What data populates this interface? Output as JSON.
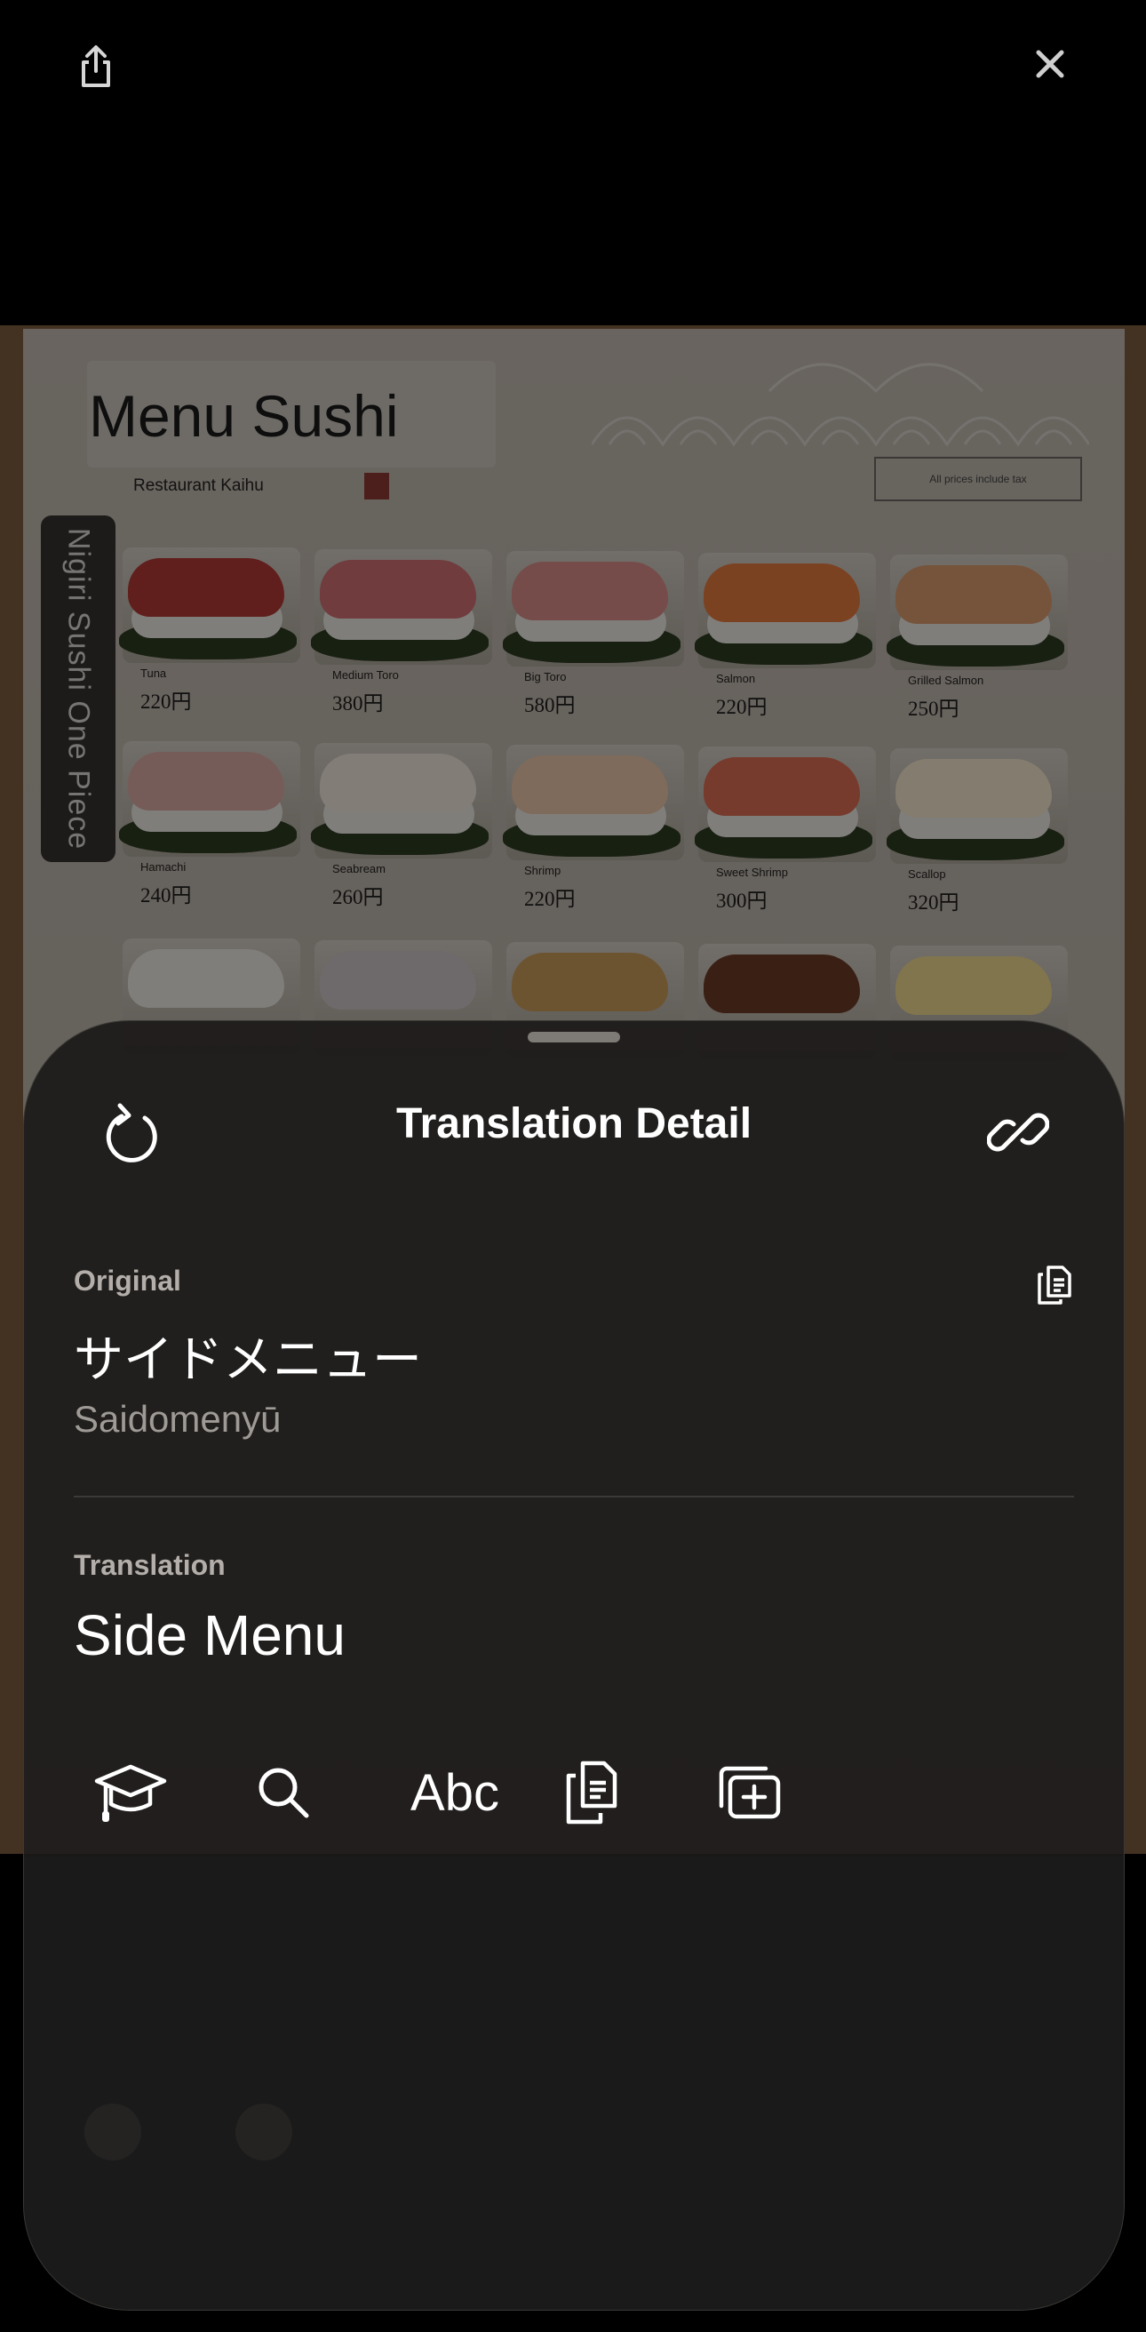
{
  "top_bar": {
    "share_icon": "share-icon",
    "close_icon": "close-icon"
  },
  "menu_photo": {
    "title": "Menu Sushi",
    "restaurant": "Restaurant Kaihu",
    "prices_note": "All prices include tax",
    "side_label": "Nigiri Sushi One Piece",
    "items": [
      {
        "name": "Tuna",
        "price": "220円",
        "color": "#b03a34"
      },
      {
        "name": "Medium Toro",
        "price": "380円",
        "color": "#cc6d70"
      },
      {
        "name": "Big Toro",
        "price": "580円",
        "color": "#d58b86"
      },
      {
        "name": "Salmon",
        "price": "220円",
        "color": "#e0793e"
      },
      {
        "name": "Grilled Salmon",
        "price": "250円",
        "color": "#d79a6c"
      },
      {
        "name": "Hamachi",
        "price": "240円",
        "color": "#d8a8a0"
      },
      {
        "name": "Seabream",
        "price": "260円",
        "color": "#ede3d8"
      },
      {
        "name": "Shrimp",
        "price": "220円",
        "color": "#e6c3a7"
      },
      {
        "name": "Sweet Shrimp",
        "price": "300円",
        "color": "#d76c52"
      },
      {
        "name": "Scallop",
        "price": "320円",
        "color": "#f0e2c8"
      }
    ]
  },
  "detail_sheet": {
    "title": "Translation Detail",
    "original_label": "Original",
    "original_text": "サイドメニュー",
    "romanization": "Saidomenyū",
    "translation_label": "Translation",
    "translation_text": "Side Menu",
    "toolbar": {
      "abc_label": "Abc"
    }
  }
}
